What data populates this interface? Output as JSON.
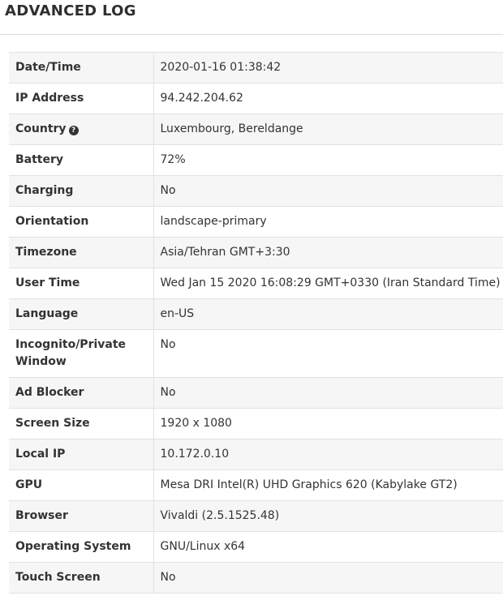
{
  "header": {
    "title": "ADVANCED LOG"
  },
  "rows": [
    {
      "label": "Date/Time",
      "value": "2020-01-16 01:38:42"
    },
    {
      "label": "IP Address",
      "value": "94.242.204.62"
    },
    {
      "label": "Country",
      "value": "Luxembourg, Bereldange",
      "help_icon": "question-circle-icon"
    },
    {
      "label": "Battery",
      "value": "72%"
    },
    {
      "label": "Charging",
      "value": "No"
    },
    {
      "label": "Orientation",
      "value": "landscape-primary"
    },
    {
      "label": "Timezone",
      "value": "Asia/Tehran GMT+3:30"
    },
    {
      "label": "User Time",
      "value": "Wed Jan 15 2020 16:08:29 GMT+0330 (Iran Standard Time)"
    },
    {
      "label": "Language",
      "value": "en-US"
    },
    {
      "label": "Incognito/Private Window",
      "value": "No"
    },
    {
      "label": "Ad Blocker",
      "value": "No"
    },
    {
      "label": "Screen Size",
      "value": "1920 x 1080"
    },
    {
      "label": "Local IP",
      "value": "10.172.0.10"
    },
    {
      "label": "GPU",
      "value": "Mesa DRI Intel(R) UHD Graphics 620 (Kabylake GT2)"
    },
    {
      "label": "Browser",
      "value": "Vivaldi (2.5.1525.48)"
    },
    {
      "label": "Operating System",
      "value": "GNU/Linux x64"
    },
    {
      "label": "Touch Screen",
      "value": "No"
    }
  ]
}
